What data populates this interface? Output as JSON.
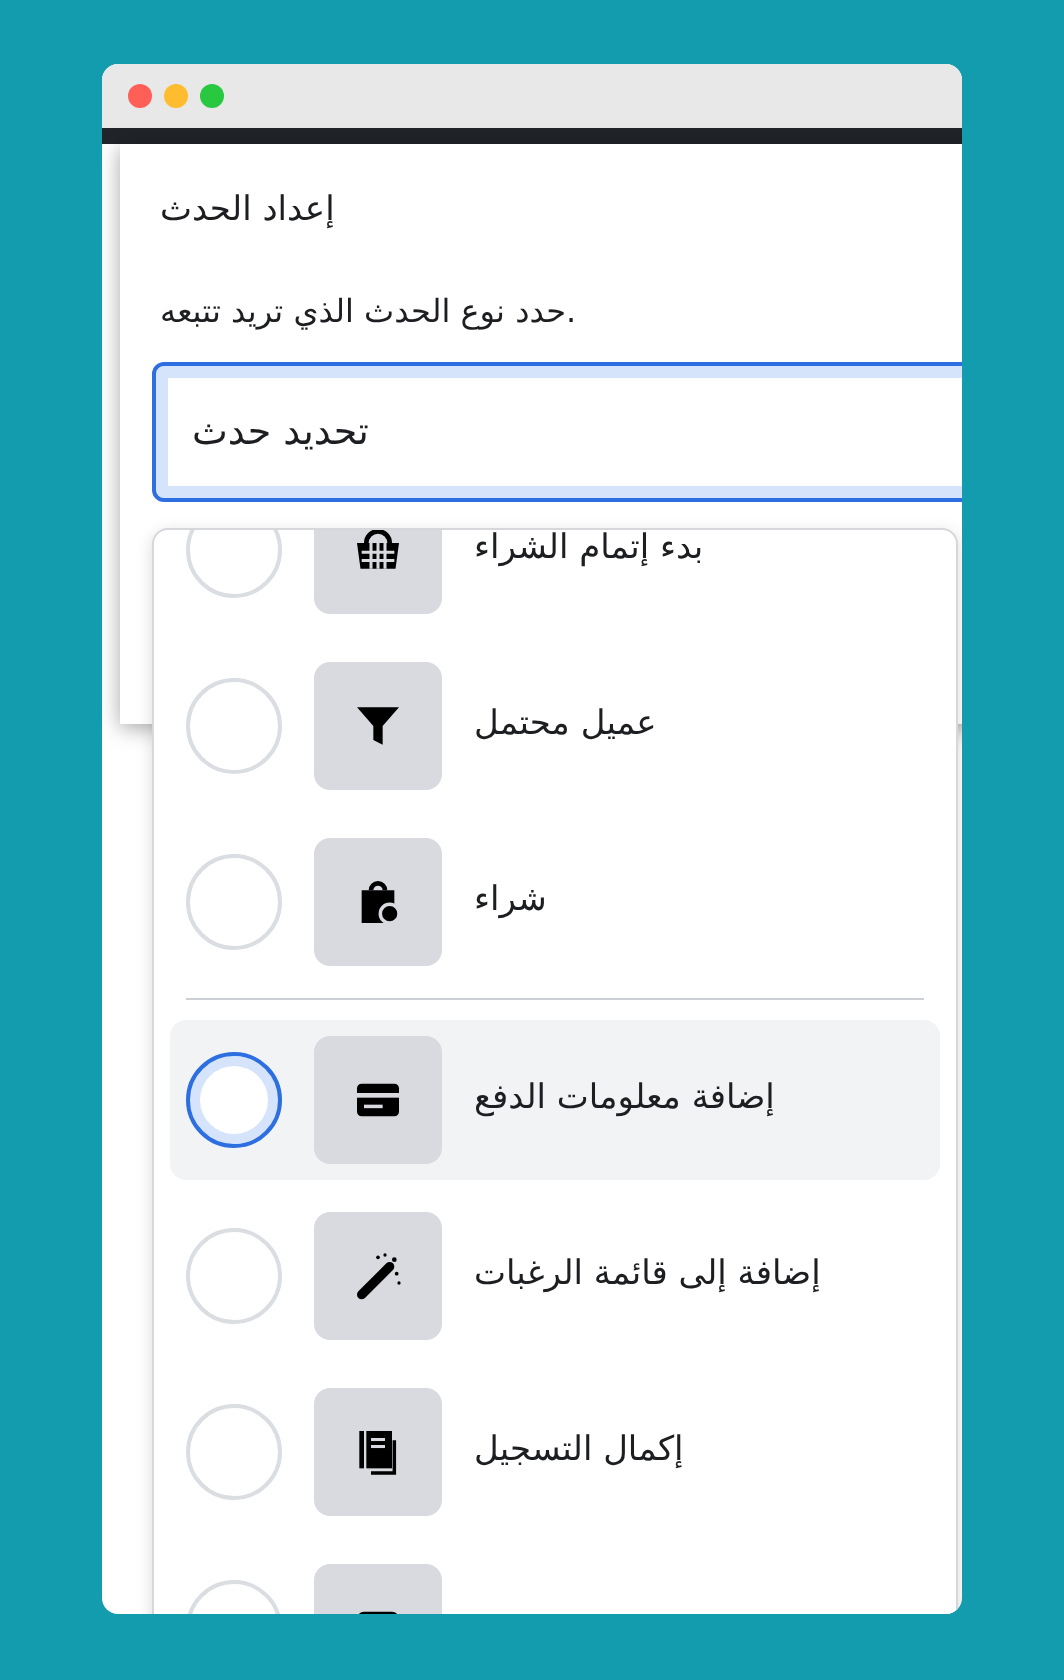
{
  "window": {
    "traffic_lights": [
      {
        "color": "#ff5f57"
      },
      {
        "color": "#febc2e"
      },
      {
        "color": "#28c840"
      }
    ]
  },
  "dialog": {
    "title": "إعداد الحدث",
    "description": "حدد نوع الحدث الذي تريد تتبعه.",
    "select": {
      "value": "تحديد حدث",
      "focused": true
    }
  },
  "events": [
    {
      "kind": "option",
      "label": "بدء إتمام الشراء",
      "selected": false
    },
    {
      "kind": "option",
      "label": "عميل محتمل",
      "selected": false
    },
    {
      "kind": "option",
      "label": "شراء",
      "selected": false
    },
    {
      "kind": "divider"
    },
    {
      "kind": "option",
      "label": "إضافة معلومات الدفع",
      "selected": true
    },
    {
      "kind": "option",
      "label": "إضافة إلى قائمة الرغبات",
      "selected": false
    },
    {
      "kind": "option",
      "label": "إكمال التسجيل",
      "selected": false
    },
    {
      "kind": "option",
      "selected": false
    }
  ]
}
